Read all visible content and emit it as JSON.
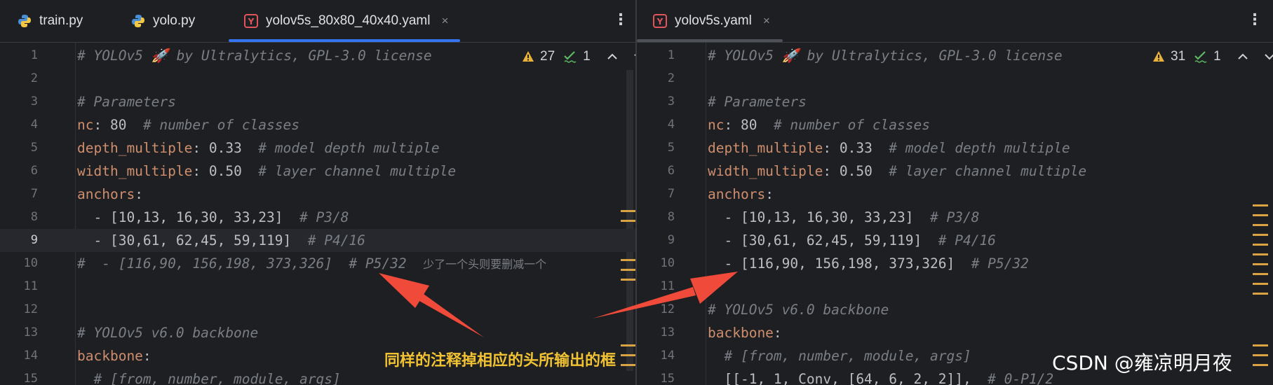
{
  "left_pane": {
    "tabs": [
      {
        "label": "train.py",
        "icon": "python-file-icon"
      },
      {
        "label": "yolo.py",
        "icon": "python-file-icon"
      },
      {
        "label": "yolov5s_80x80_40x40.yaml",
        "icon": "yaml-file-icon",
        "close": "×",
        "active": true
      }
    ],
    "menu": "⋮",
    "warnings": "27",
    "checks": "1",
    "lines": [
      {
        "n": "1"
      },
      {
        "n": "2"
      },
      {
        "n": "3"
      },
      {
        "n": "4"
      },
      {
        "n": "5"
      },
      {
        "n": "6"
      },
      {
        "n": "7"
      },
      {
        "n": "8"
      },
      {
        "n": "9"
      },
      {
        "n": "10"
      },
      {
        "n": "11"
      },
      {
        "n": "12"
      },
      {
        "n": "13"
      },
      {
        "n": "14"
      },
      {
        "n": "15"
      }
    ]
  },
  "right_pane": {
    "tabs": [
      {
        "label": "yolov5s.yaml",
        "icon": "yaml-file-icon",
        "close": "×",
        "active": true
      }
    ],
    "menu": "⋮",
    "warnings": "31",
    "checks": "1",
    "lines": [
      {
        "n": "1"
      },
      {
        "n": "2"
      },
      {
        "n": "3"
      },
      {
        "n": "4"
      },
      {
        "n": "5"
      },
      {
        "n": "6"
      },
      {
        "n": "7"
      },
      {
        "n": "8"
      },
      {
        "n": "9"
      },
      {
        "n": "10"
      },
      {
        "n": "11"
      },
      {
        "n": "12"
      },
      {
        "n": "13"
      },
      {
        "n": "14"
      },
      {
        "n": "15"
      }
    ]
  },
  "code": {
    "license": "# YOLOv5 🚀 by Ultralytics, GPL-3.0 license",
    "params": "# Parameters",
    "nc_key": "nc",
    "nc_val": ": 80  ",
    "nc_comment": "# number of classes",
    "depth_key": "depth_multiple",
    "depth_val": ": 0.33  ",
    "depth_comment": "# model depth multiple",
    "width_key": "width_multiple",
    "width_val": ": 0.50  ",
    "width_comment": "# layer channel multiple",
    "anchors_key": "anchors",
    "colon": ":",
    "a1": "  - [10,13, 16,30, 33,23]  ",
    "a1_comment": "# P3/8",
    "a2": "  - [30,61, 62,45, 59,119]  ",
    "a2_comment": "# P4/16",
    "a3_commented": "#  - [116,90, 156,198, 373,326]  # P5/32  ",
    "a3_note": "少了一个头则要删减一个",
    "a3": "  - [116,90, 156,198, 373,326]  ",
    "a3_comment": "# P5/32",
    "backbone_comment": "# YOLOv5 v6.0 backbone",
    "backbone_key": "backbone",
    "args_comment": "  # [from, number, module, args]",
    "first_layer": "  [[-1, 1, Conv, [64, 6, 2, 2]],  ",
    "first_layer_comment": "# 0-P1/2"
  },
  "annotation": "同样的注释掉相应的头所输出的框",
  "watermark": "CSDN @雍凉明月夜",
  "colors": {
    "background": "#1e1f22",
    "comment": "#7a7e85",
    "key": "#cf8e6d",
    "arrow": "#f04a3a",
    "annotation": "#f1c232",
    "tab_underline_active": "#3574f0"
  }
}
